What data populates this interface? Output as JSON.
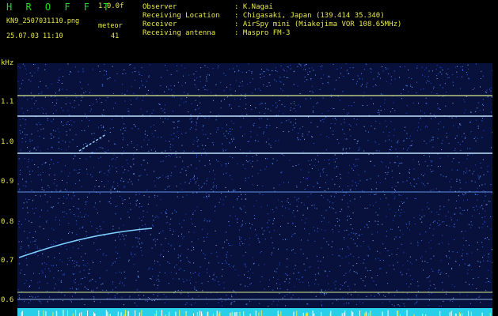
{
  "header": {
    "app_title": "H R O F F T",
    "version": "1.0.0f",
    "filename": "KN9_2507031110.png",
    "datetime": "25.07.03 11:10",
    "meteor_label": "meteor",
    "meteor_count": "41",
    "info": [
      {
        "label": "Observer",
        "value": ": K.Nagai"
      },
      {
        "label": "Receiving Location",
        "value": ": Chigasaki, Japan (139.414 35.340)"
      },
      {
        "label": "Receiver",
        "value": ": AirSpy mini (Miakejima VOR 108.65MHz)"
      },
      {
        "label": "Receiving antenna",
        "value": ": Maspro FM-3"
      }
    ]
  },
  "plot": {
    "y_unit": "kHz",
    "y_ticks": [
      "1.1",
      "1.0",
      "0.9",
      "0.8",
      "0.7",
      "0.6"
    ],
    "x_ticks": [
      "1111",
      "1112",
      "1113",
      "1114",
      "1115",
      "1116",
      "1117",
      "1118",
      "1119",
      "1120"
    ],
    "colors": {
      "background": "#08103c",
      "noise": "#3c7cff",
      "carrier": "#d8ec8c",
      "meteor": "#7fd0ff",
      "text": "#e8e84a"
    }
  }
}
